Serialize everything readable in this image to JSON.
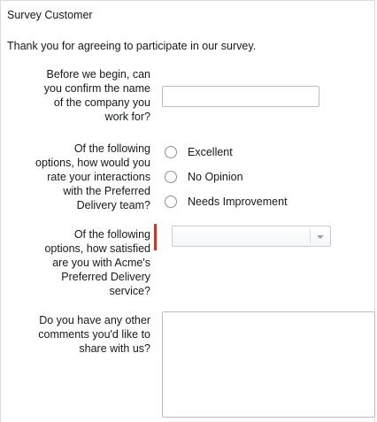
{
  "survey": {
    "title": "Survey Customer",
    "intro": "Thank you for agreeing to participate in our survey."
  },
  "questions": {
    "company": {
      "label_lines": [
        "Before we begin, can",
        "you confirm the name",
        "of the company you",
        "work for?"
      ],
      "value": ""
    },
    "rating": {
      "label_lines": [
        "Of the following",
        "options, how would you",
        "rate your interactions",
        "with the Preferred",
        "Delivery team?"
      ],
      "options": [
        "Excellent",
        "No Opinion",
        "Needs Improvement"
      ]
    },
    "satisfaction": {
      "label_lines": [
        "Of the following",
        "options, how satisfied",
        "are you with Acme's",
        "Preferred Delivery",
        "service?"
      ],
      "selected": "",
      "required": true
    },
    "comments": {
      "label_lines": [
        "Do you have any other",
        "comments you'd like to",
        "share with us?"
      ],
      "value": ""
    }
  },
  "icons": {
    "select_arrow": "chevron-down-icon"
  },
  "colors": {
    "required": "#c23934",
    "border": "#b9bdc2"
  }
}
